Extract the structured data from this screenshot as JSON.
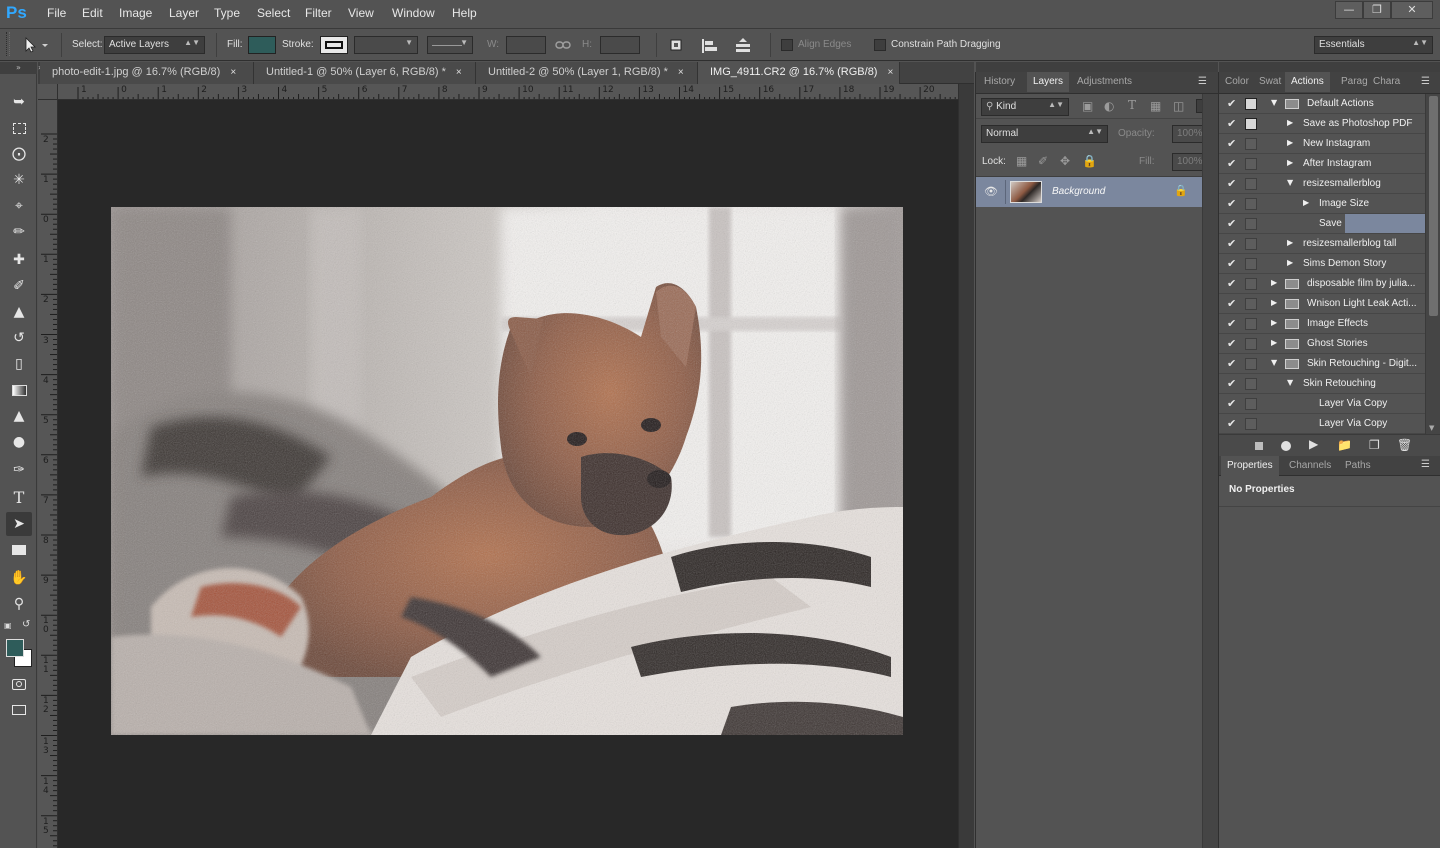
{
  "app": {
    "logo": "Ps",
    "menu": [
      "File",
      "Edit",
      "Image",
      "Layer",
      "Type",
      "Select",
      "Filter",
      "View",
      "Window",
      "Help"
    ],
    "window_controls": {
      "minimize": "—",
      "restore": "❐",
      "close": "✕"
    }
  },
  "options": {
    "select_label": "Select:",
    "select_value": "Active Layers",
    "fill_label": "Fill:",
    "fill_color": "#2e5c5a",
    "stroke_label": "Stroke:",
    "w_label": "W:",
    "h_label": "H:",
    "align_edges": "Align Edges",
    "constrain_path": "Constrain Path Dragging",
    "workspace": "Essentials"
  },
  "tabs": [
    {
      "label": "photo-edit-1.jpg @ 16.7% (RGB/8)",
      "close": "×"
    },
    {
      "label": "Untitled-1 @ 50% (Layer 6, RGB/8) *",
      "close": "×"
    },
    {
      "label": "Untitled-2 @ 50% (Layer 1, RGB/8) *",
      "close": "×"
    },
    {
      "label": "IMG_4911.CR2 @ 16.7% (RGB/8)",
      "close": "×"
    }
  ],
  "ruler_top": [
    "1",
    "0",
    "1",
    "2",
    "3",
    "4",
    "5",
    "6",
    "7",
    "8",
    "9",
    "10",
    "11",
    "12",
    "13",
    "14",
    "15",
    "16",
    "17",
    "18",
    "19",
    "20"
  ],
  "ruler_left": [
    "2",
    "1",
    "0",
    "1",
    "2",
    "3",
    "4",
    "5",
    "6",
    "7",
    "8",
    "9",
    "10",
    "11",
    "12",
    "13",
    "14",
    "15"
  ],
  "layers_panel": {
    "tabs": [
      "History",
      "Layers",
      "Adjustments"
    ],
    "kind_label": "Kind",
    "blend_mode": "Normal",
    "opacity_label": "Opacity:",
    "opacity_value": "100%",
    "lock_label": "Lock:",
    "fill_label": "Fill:",
    "fill_value": "100%",
    "layer_name": "Background"
  },
  "actions_panel": {
    "tabs": [
      "Color",
      "Swat",
      "Actions",
      "Parag",
      "Chara"
    ],
    "items": [
      {
        "label": "Default Actions",
        "level": 0,
        "folder": true,
        "expanded": true,
        "box": "dialog"
      },
      {
        "label": "Save as Photoshop PDF",
        "level": 1,
        "folder": false,
        "expanded": false,
        "box": "dialog"
      },
      {
        "label": "New Instagram",
        "level": 1,
        "folder": false,
        "expanded": false,
        "box": ""
      },
      {
        "label": "After Instagram",
        "level": 1,
        "folder": false,
        "expanded": false,
        "box": ""
      },
      {
        "label": "resizesmallerblog",
        "level": 1,
        "folder": false,
        "expanded": true,
        "box": ""
      },
      {
        "label": "Image Size",
        "level": 2,
        "folder": false,
        "expanded": false,
        "box": ""
      },
      {
        "label": "Save",
        "level": 2,
        "folder": false,
        "expanded": null,
        "box": "",
        "selected": true
      },
      {
        "label": "resizesmallerblog tall",
        "level": 1,
        "folder": false,
        "expanded": false,
        "box": ""
      },
      {
        "label": "Sims Demon Story",
        "level": 1,
        "folder": false,
        "expanded": false,
        "box": ""
      },
      {
        "label": "disposable film by julia...",
        "level": 0,
        "folder": true,
        "expanded": false,
        "box": ""
      },
      {
        "label": "Wnison Light Leak Acti...",
        "level": 0,
        "folder": true,
        "expanded": false,
        "box": ""
      },
      {
        "label": "Image Effects",
        "level": 0,
        "folder": true,
        "expanded": false,
        "box": ""
      },
      {
        "label": "Ghost Stories",
        "level": 0,
        "folder": true,
        "expanded": false,
        "box": ""
      },
      {
        "label": "Skin Retouching - Digit...",
        "level": 0,
        "folder": true,
        "expanded": true,
        "box": ""
      },
      {
        "label": "Skin Retouching",
        "level": 1,
        "folder": false,
        "expanded": true,
        "box": ""
      },
      {
        "label": "Layer Via Copy",
        "level": 2,
        "folder": false,
        "expanded": null,
        "box": ""
      },
      {
        "label": "Layer Via Copy",
        "level": 2,
        "folder": false,
        "expanded": null,
        "box": ""
      }
    ]
  },
  "properties_panel": {
    "tabs": [
      "Properties",
      "Channels",
      "Paths"
    ],
    "empty_text": "No Properties"
  }
}
